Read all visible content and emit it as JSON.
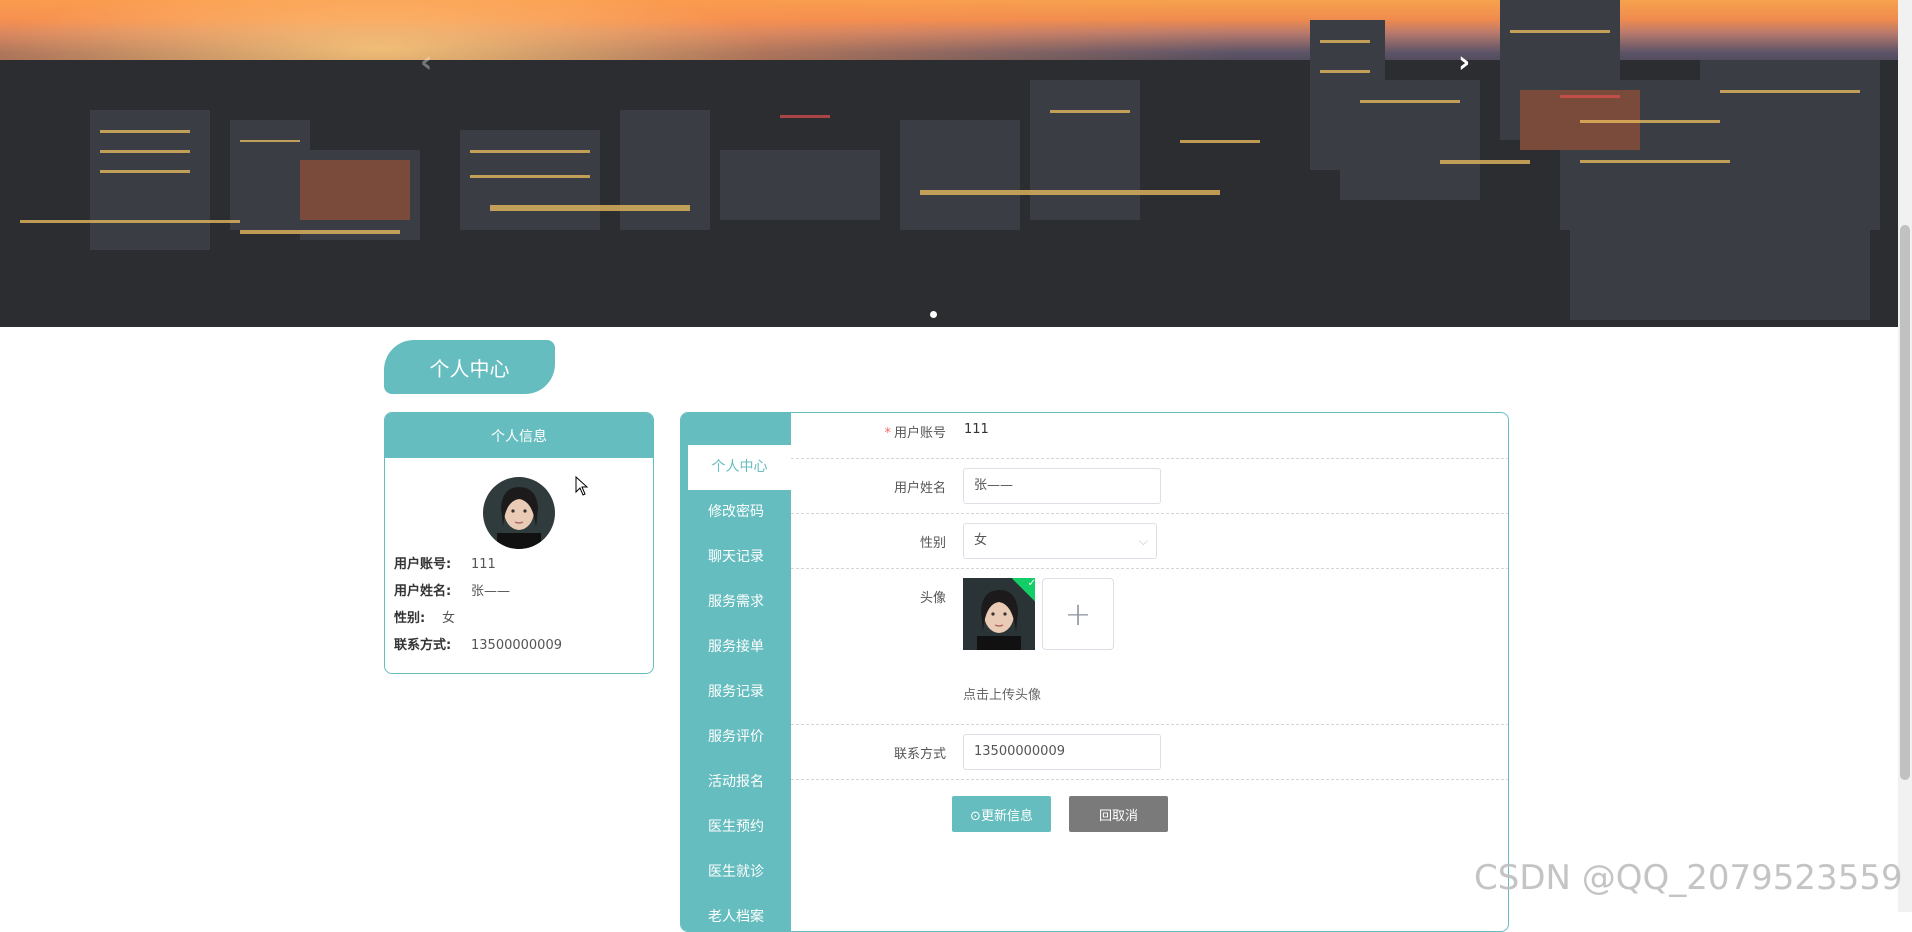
{
  "banner": {
    "prev_icon": "chevron-left-icon",
    "next_icon": "chevron-right-icon",
    "prev_glyph": "‹",
    "next_glyph": "›"
  },
  "page_title": "个人中心",
  "profile_card": {
    "header": "个人信息",
    "fields": [
      {
        "label": "用户账号:",
        "value": "111"
      },
      {
        "label": "用户姓名:",
        "value": "张——"
      },
      {
        "label": "性别:",
        "value": "女"
      },
      {
        "label": "联系方式:",
        "value": "13500000009"
      }
    ]
  },
  "sidebar": {
    "items": [
      {
        "label": "个人中心",
        "active": true
      },
      {
        "label": "修改密码"
      },
      {
        "label": "聊天记录"
      },
      {
        "label": "服务需求"
      },
      {
        "label": "服务接单"
      },
      {
        "label": "服务记录"
      },
      {
        "label": "服务评价"
      },
      {
        "label": "活动报名"
      },
      {
        "label": "医生预约"
      },
      {
        "label": "医生就诊"
      },
      {
        "label": "老人档案"
      }
    ]
  },
  "form": {
    "account_label": "用户账号",
    "account_value": "111",
    "name_label": "用户姓名",
    "name_value": "张——",
    "gender_label": "性别",
    "gender_value": "女",
    "avatar_label": "头像",
    "upload_hint": "点击上传头像",
    "upload_plus": "+",
    "phone_label": "联系方式",
    "phone_value": "13500000009",
    "update_button": "⊙更新信息",
    "cancel_button": "回取消"
  },
  "watermark": "CSDN @QQ_2079523559",
  "colors": {
    "accent": "#66bdbf",
    "required": "#f56c6c",
    "success": "#13ce66",
    "cancel": "#7a7a7a"
  }
}
